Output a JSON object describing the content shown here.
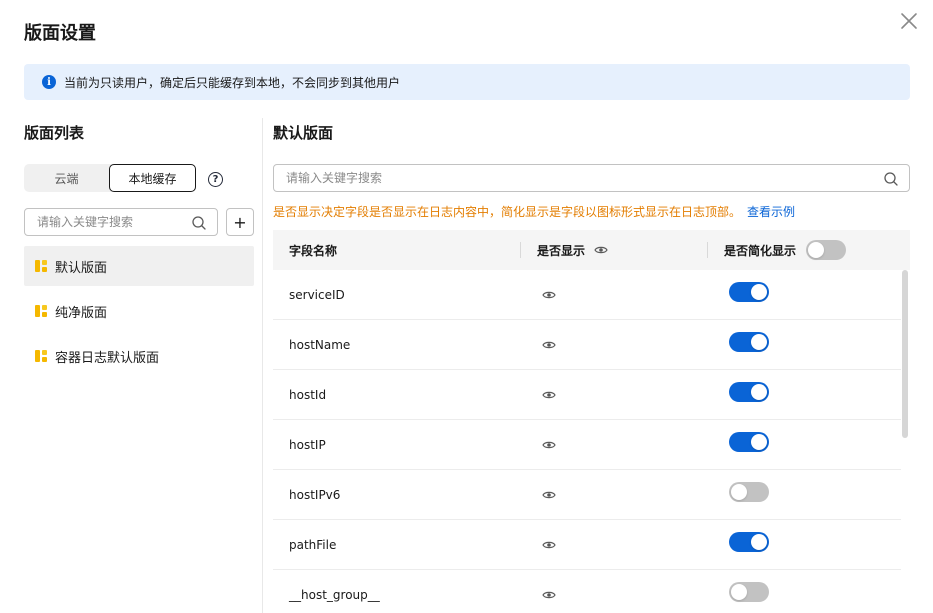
{
  "dialog": {
    "title": "版面设置"
  },
  "notice": {
    "text": "当前为只读用户，确定后只能缓存到本地，不会同步到其他用户"
  },
  "left": {
    "title": "版面列表",
    "tabs": [
      "云端",
      "本地缓存"
    ],
    "active_tab": 1,
    "search_placeholder": "请输入关键字搜索",
    "add_label": "+",
    "items": [
      {
        "label": "默认版面",
        "active": true
      },
      {
        "label": "纯净版面",
        "active": false
      },
      {
        "label": "容器日志默认版面",
        "active": false
      }
    ]
  },
  "right": {
    "title": "默认版面",
    "search_placeholder": "请输入关键字搜索",
    "hint": "是否显示决定字段是否显示在日志内容中，简化显示是字段以图标形式显示在日志顶部。",
    "hint_link": "查看示例",
    "columns": [
      "字段名称",
      "是否显示",
      "是否简化显示"
    ],
    "header_simplify_all": false,
    "rows": [
      {
        "field": "serviceID",
        "simplified": true
      },
      {
        "field": "hostName",
        "simplified": true
      },
      {
        "field": "hostId",
        "simplified": true
      },
      {
        "field": "hostIP",
        "simplified": true
      },
      {
        "field": "hostIPv6",
        "simplified": false
      },
      {
        "field": "pathFile",
        "simplified": true
      },
      {
        "field": "__host_group__",
        "simplified": false
      }
    ]
  },
  "colors": {
    "primary": "#0a64d6",
    "warning_text": "#e37d00",
    "notice_bg": "#e6f0fd",
    "toggle_off": "#c2c2c2"
  }
}
